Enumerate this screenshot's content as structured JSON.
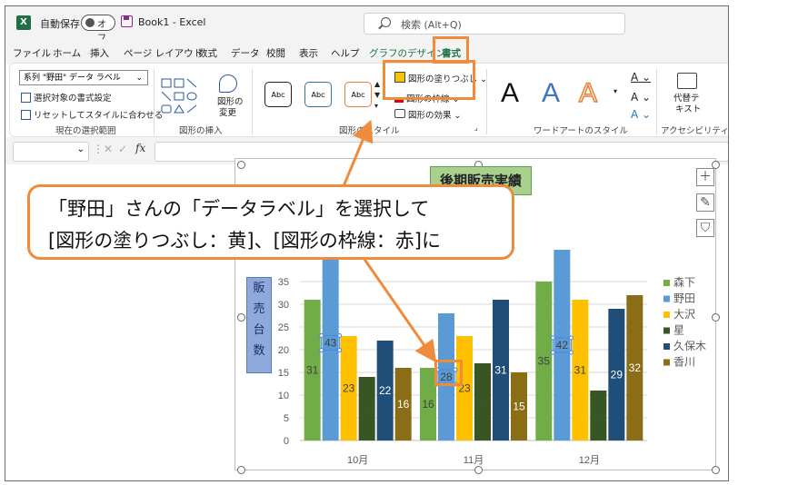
{
  "titlebar": {
    "app_icon": "excel-icon",
    "autosave_label": "自動保存",
    "toggle_text": "オフ",
    "book_title": "Book1  -  Excel",
    "search_placeholder": "検索 (Alt+Q)"
  },
  "tabs": [
    "ファイル",
    "ホーム",
    "挿入",
    "ページ レイアウト",
    "数式",
    "データ",
    "校閲",
    "表示",
    "ヘルプ",
    "グラフのデザイン",
    "書式"
  ],
  "active_tab": "書式",
  "ribbon": {
    "selection_dropdown": "系列 \"野田\" データ ラベル",
    "format_selection": "選択対象の書式設定",
    "reset_style": "リセットしてスタイルに合わせる",
    "group_current_selection": "現在の選択範囲",
    "change_shape": "図形の\n変更",
    "change_shape_l1": "図形の",
    "change_shape_l2": "変更",
    "group_insert_shapes": "図形の挿入",
    "abc": "Abc",
    "shape_fill": "図形の塗りつぶし",
    "shape_outline": "図形の枠線",
    "shape_effects": "図形の効果",
    "group_shape_styles": "図形のスタイル",
    "group_wordart": "ワードアートのスタイル",
    "alt_text_l1": "代替テ",
    "alt_text_l2": "キスト",
    "group_accessibility": "アクセシビリティ",
    "wordart_letter": "A"
  },
  "formula_bar": {
    "fx": "fx",
    "cancel": "✕",
    "enter": "✓"
  },
  "callout": {
    "line1": "「野田」さんの「データラベル」を選択して",
    "line2": "[図形の塗りつぶし：黄]、[図形の枠線：赤]に"
  },
  "colors": {
    "accent_orange": "#ef8b3a",
    "excel_green": "#1e7145"
  },
  "chart_data": {
    "type": "bar",
    "title": "後期販売実績",
    "ylabel_chars": [
      "販",
      "売",
      "台",
      "数"
    ],
    "categories": [
      "10月",
      "11月",
      "12月"
    ],
    "ylim": [
      0,
      40
    ],
    "yticks": [
      0,
      5,
      10,
      15,
      20,
      25,
      30,
      35
    ],
    "legend_position": "right",
    "series": [
      {
        "name": "森下",
        "color": "#70ad47",
        "values": [
          31,
          16,
          35
        ]
      },
      {
        "name": "野田",
        "color": "#5b9bd5",
        "values": [
          43,
          28,
          42
        ]
      },
      {
        "name": "大沢",
        "color": "#ffc000",
        "values": [
          23,
          23,
          31
        ]
      },
      {
        "name": "星",
        "color": "#375623",
        "values": [
          14,
          17,
          11
        ]
      },
      {
        "name": "久保木",
        "color": "#1f4e79",
        "values": [
          22,
          31,
          29
        ]
      },
      {
        "name": "香川",
        "color": "#8a6d15",
        "values": [
          16,
          15,
          32
        ]
      }
    ]
  }
}
